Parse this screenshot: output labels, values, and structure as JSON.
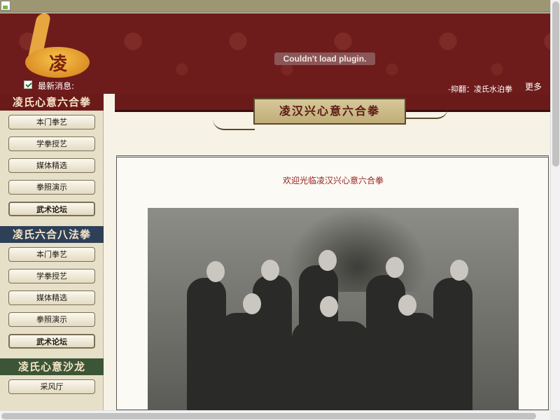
{
  "header": {
    "plugin_message": "Couldn't load plugin.",
    "news_label": "最新消息:",
    "ticker_text": "-抑翻：凌氏水泊拳",
    "more_label": "更多>>"
  },
  "logo": {
    "char": "凌"
  },
  "sidebar": {
    "sections": [
      {
        "title": "凌氏心意六合拳",
        "items": [
          "本门拳艺",
          "学拳授艺",
          "媒体精选",
          "拳照演示",
          "武术论坛"
        ]
      },
      {
        "title": "凌氏六合八法拳",
        "items": [
          "本门拳艺",
          "学拳授艺",
          "媒体精选",
          "拳照演示",
          "武术论坛"
        ]
      },
      {
        "title": "凌氏心意沙龙",
        "items": [
          "采风厅"
        ]
      }
    ]
  },
  "main": {
    "banner_title": "凌汉兴心意六合拳",
    "welcome": "欢迎光临凌汉兴心意六合拳"
  },
  "colors": {
    "banner": "#6e1b1b",
    "accent": "#9a2222",
    "sidebar_bg": "#e7e0c9"
  }
}
